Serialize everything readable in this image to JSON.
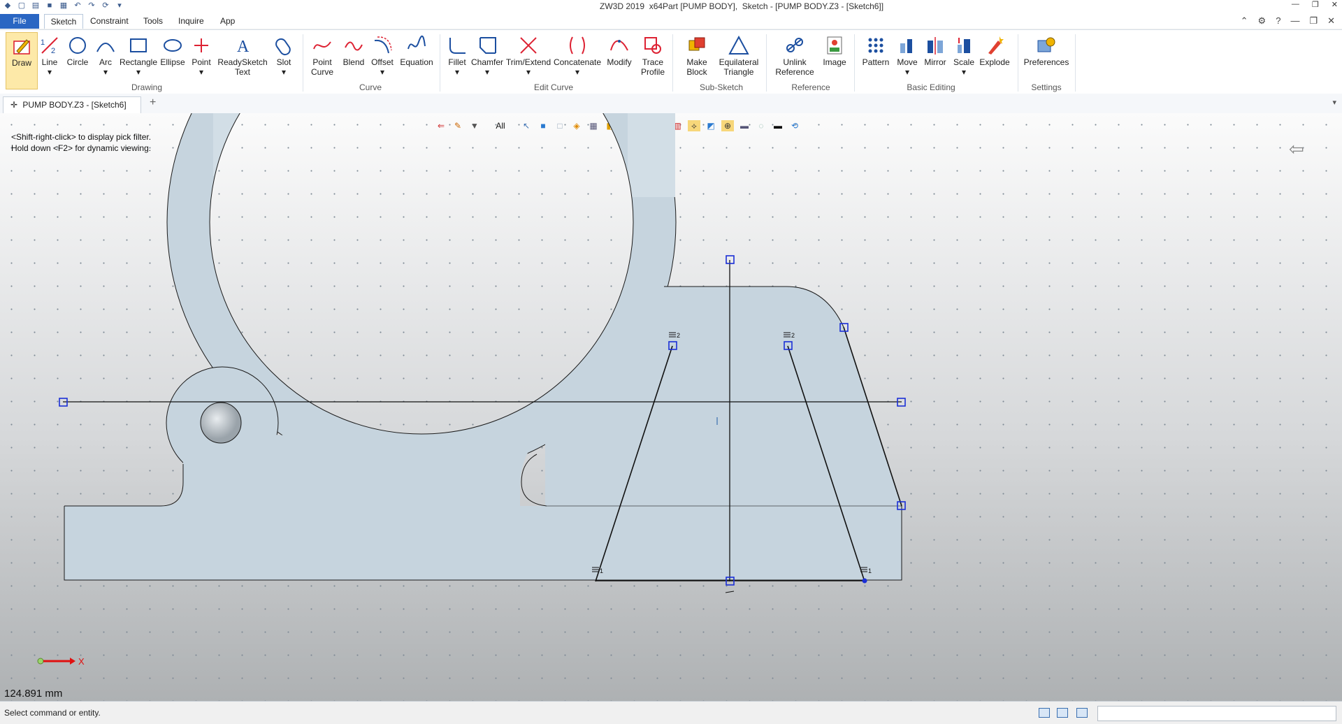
{
  "title": {
    "app": "ZW3D 2019  x64",
    "doc": "Part [PUMP BODY],  Sketch - [PUMP BODY.Z3 - [Sketch6]]"
  },
  "menu": {
    "file": "File",
    "sketch": "Sketch",
    "constraint": "Constraint",
    "tools": "Tools",
    "inquire": "Inquire",
    "app": "App"
  },
  "ribbon": {
    "groups": {
      "drawing": "Drawing",
      "curve": "Curve",
      "edit_curve": "Edit Curve",
      "sub_sketch": "Sub-Sketch",
      "reference": "Reference",
      "basic_editing": "Basic Editing",
      "settings": "Settings"
    },
    "buttons": {
      "draw": "Draw",
      "line": "Line",
      "circle": "Circle",
      "arc": "Arc",
      "rectangle": "Rectangle",
      "ellipse": "Ellipse",
      "point": "Point",
      "readysketch_1": "ReadySketch",
      "readysketch_2": "Text",
      "slot": "Slot",
      "point_curve_1": "Point",
      "point_curve_2": "Curve",
      "blend": "Blend",
      "offset": "Offset",
      "equation": "Equation",
      "fillet": "Fillet",
      "chamfer": "Chamfer",
      "trim": "Trim/Extend",
      "concatenate": "Concatenate",
      "modify": "Modify",
      "trace_1": "Trace",
      "trace_2": "Profile",
      "makeblock_1": "Make",
      "makeblock_2": "Block",
      "eqtri_1": "Equilateral",
      "eqtri_2": "Triangle",
      "unlink_1": "Unlink",
      "unlink_2": "Reference",
      "image": "Image",
      "pattern": "Pattern",
      "move": "Move",
      "mirror": "Mirror",
      "scale": "Scale",
      "explode": "Explode",
      "preferences": "Preferences"
    }
  },
  "tab": {
    "label": "PUMP BODY.Z3 - [Sketch6]"
  },
  "viewport": {
    "hint1": "<Shift-right-click> to display pick filter.",
    "hint2": "Hold down <F2> for dynamic viewing.",
    "filter": "All",
    "measure": "124.891 mm",
    "axis_label": "X",
    "constraint_tag_1": "2",
    "constraint_tag_2": "2",
    "constraint_tag_3": "1",
    "constraint_tag_4": "1"
  },
  "status": {
    "text": "Select command or entity."
  },
  "colors": {
    "file_menu": "#2a66c3",
    "part_fill": "#c6d4de",
    "handle": "#1b2fd6",
    "active_tool": "#fde9a8"
  }
}
